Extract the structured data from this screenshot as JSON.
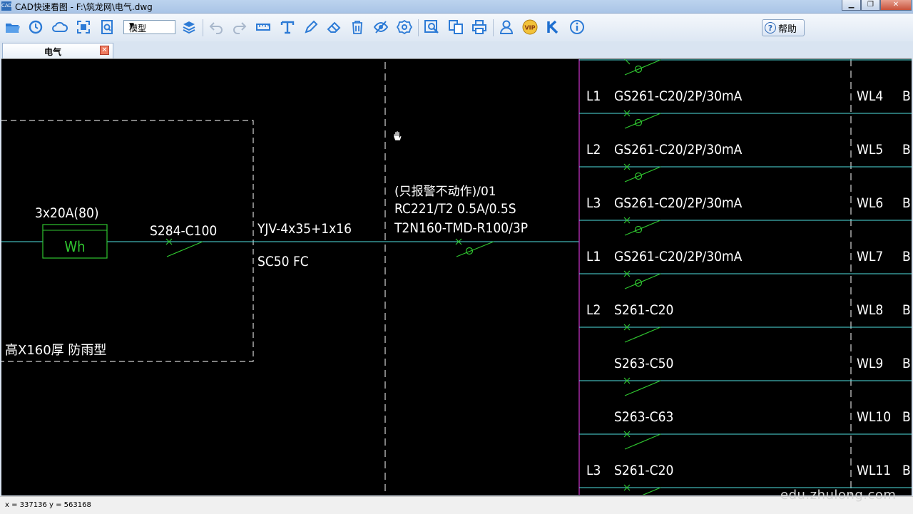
{
  "window": {
    "title": "CAD快速看图 - F:\\筑龙网\\电气.dwg",
    "app_icon_text": "CAD"
  },
  "toolbar": {
    "space_select": "模型",
    "help_label": "帮助",
    "icons": [
      "open-folder-icon",
      "history-icon",
      "cloud-icon",
      "fit-screen-icon",
      "zoom-window-icon",
      "layers-icon",
      "undo-icon",
      "redo-icon",
      "measure-icon",
      "text-icon",
      "pencil-icon",
      "eraser-icon",
      "trash-icon",
      "eye-icon",
      "settings-icon",
      "find-text-icon",
      "compare-icon",
      "print-icon",
      "user-icon",
      "vip-icon",
      "k-logo-icon",
      "info-icon"
    ]
  },
  "tabs": [
    {
      "label": "电气"
    }
  ],
  "drawing": {
    "meter_rating": "3x20A(80)",
    "meter_label": "Wh",
    "main_breaker": "S284-C100",
    "cable": "YJV-4x35+1x16",
    "conduit": "SC50 FC",
    "box_note": "高X160厚 防雨型",
    "rcd_note": "(只报警不动作)/01",
    "rcd_model": "RC221/T2 0.5A/0.5S",
    "incoming_breaker": "T2N160-TMD-R100/3P",
    "circuits": [
      {
        "phase": "L1",
        "device": "GS261-C20/2P/30mA",
        "circuit": "WL4",
        "rcd": true
      },
      {
        "phase": "L2",
        "device": "GS261-C20/2P/30mA",
        "circuit": "WL5",
        "rcd": true
      },
      {
        "phase": "L3",
        "device": "GS261-C20/2P/30mA",
        "circuit": "WL6",
        "rcd": true
      },
      {
        "phase": "L1",
        "device": "GS261-C20/2P/30mA",
        "circuit": "WL7",
        "rcd": true
      },
      {
        "phase": "L2",
        "device": "S261-C20",
        "circuit": "WL8",
        "rcd": false
      },
      {
        "phase": "",
        "device": "S263-C50",
        "circuit": "WL9",
        "rcd": false
      },
      {
        "phase": "",
        "device": "S263-C63",
        "circuit": "WL10",
        "rcd": false
      },
      {
        "phase": "L3",
        "device": "S261-C20",
        "circuit": "WL11",
        "rcd": false
      }
    ],
    "trailing_label": "B",
    "colors": {
      "line": "#4fe0e0",
      "device": "#2fc42f",
      "text": "#ffffff",
      "busbar": "#c030c0"
    }
  },
  "status": {
    "coords": "x = 337136  y = 563168"
  },
  "watermark": "edu.zhulong.com"
}
